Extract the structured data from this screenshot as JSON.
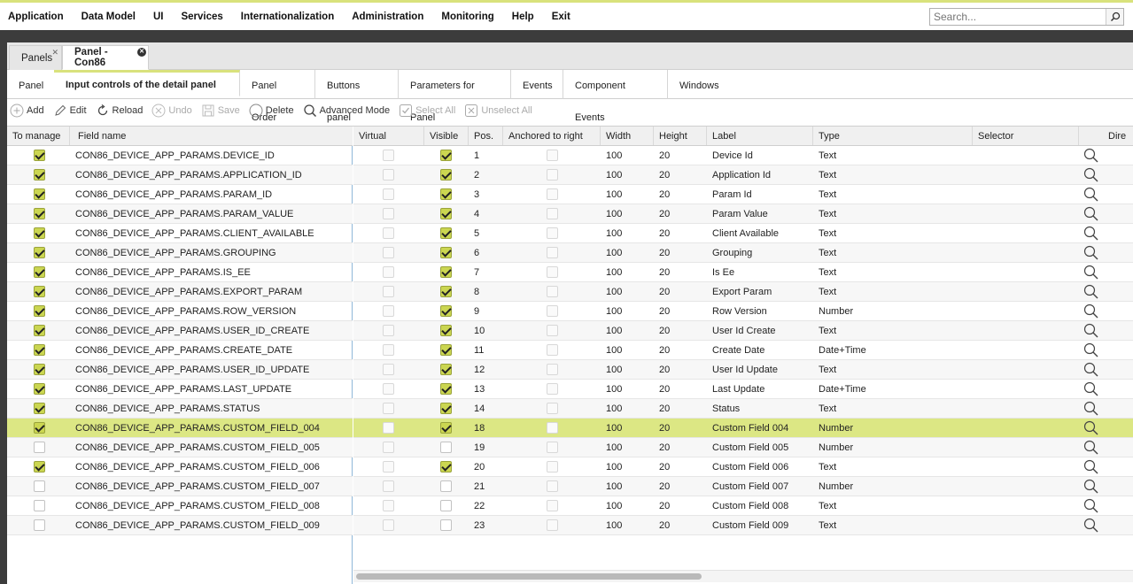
{
  "menu": [
    "Application",
    "Data Model",
    "UI",
    "Services",
    "Internationalization",
    "Administration",
    "Monitoring",
    "Help",
    "Exit"
  ],
  "search": {
    "placeholder": "Search..."
  },
  "doc_tabs": [
    {
      "label": "Panels",
      "active": false
    },
    {
      "label": "Panel - Con86",
      "active": true
    }
  ],
  "sub_tabs": [
    "Panel",
    "Input controls of the detail panel",
    "Panel Order",
    "Buttons panel",
    "Parameters for Panel",
    "Events",
    "Component Events",
    "Windows"
  ],
  "sub_tab_active": 1,
  "toolbar": {
    "add": "Add",
    "edit": "Edit",
    "reload": "Reload",
    "undo": "Undo",
    "save": "Save",
    "delete": "Delete",
    "advanced": "Advanced Mode",
    "select_all": "Select All",
    "unselect_all": "Unselect All"
  },
  "columns": {
    "to_manage": "To manage",
    "field_name": "Field name",
    "virtual": "Virtual",
    "visible": "Visible",
    "pos": "Pos.",
    "anchored": "Anchored to right",
    "width": "Width",
    "height": "Height",
    "label": "Label",
    "type": "Type",
    "selector": "Selector",
    "dir": "Dire"
  },
  "rows": [
    {
      "manage": true,
      "field": "CON86_DEVICE_APP_PARAMS.DEVICE_ID",
      "virtual": false,
      "visible": true,
      "pos": "1",
      "width": "100",
      "height": "20",
      "label": "Device Id",
      "type": "Text"
    },
    {
      "manage": true,
      "field": "CON86_DEVICE_APP_PARAMS.APPLICATION_ID",
      "virtual": false,
      "visible": true,
      "pos": "2",
      "width": "100",
      "height": "20",
      "label": "Application Id",
      "type": "Text"
    },
    {
      "manage": true,
      "field": "CON86_DEVICE_APP_PARAMS.PARAM_ID",
      "virtual": false,
      "visible": true,
      "pos": "3",
      "width": "100",
      "height": "20",
      "label": "Param Id",
      "type": "Text"
    },
    {
      "manage": true,
      "field": "CON86_DEVICE_APP_PARAMS.PARAM_VALUE",
      "virtual": false,
      "visible": true,
      "pos": "4",
      "width": "100",
      "height": "20",
      "label": "Param Value",
      "type": "Text"
    },
    {
      "manage": true,
      "field": "CON86_DEVICE_APP_PARAMS.CLIENT_AVAILABLE",
      "virtual": false,
      "visible": true,
      "pos": "5",
      "width": "100",
      "height": "20",
      "label": "Client Available",
      "type": "Text"
    },
    {
      "manage": true,
      "field": "CON86_DEVICE_APP_PARAMS.GROUPING",
      "virtual": false,
      "visible": true,
      "pos": "6",
      "width": "100",
      "height": "20",
      "label": "Grouping",
      "type": "Text"
    },
    {
      "manage": true,
      "field": "CON86_DEVICE_APP_PARAMS.IS_EE",
      "virtual": false,
      "visible": true,
      "pos": "7",
      "width": "100",
      "height": "20",
      "label": "Is Ee",
      "type": "Text"
    },
    {
      "manage": true,
      "field": "CON86_DEVICE_APP_PARAMS.EXPORT_PARAM",
      "virtual": false,
      "visible": true,
      "pos": "8",
      "width": "100",
      "height": "20",
      "label": "Export Param",
      "type": "Text"
    },
    {
      "manage": true,
      "field": "CON86_DEVICE_APP_PARAMS.ROW_VERSION",
      "virtual": false,
      "visible": true,
      "pos": "9",
      "width": "100",
      "height": "20",
      "label": "Row Version",
      "type": "Number"
    },
    {
      "manage": true,
      "field": "CON86_DEVICE_APP_PARAMS.USER_ID_CREATE",
      "virtual": false,
      "visible": true,
      "pos": "10",
      "width": "100",
      "height": "20",
      "label": "User Id Create",
      "type": "Text"
    },
    {
      "manage": true,
      "field": "CON86_DEVICE_APP_PARAMS.CREATE_DATE",
      "virtual": false,
      "visible": true,
      "pos": "11",
      "width": "100",
      "height": "20",
      "label": "Create Date",
      "type": "Date+Time"
    },
    {
      "manage": true,
      "field": "CON86_DEVICE_APP_PARAMS.USER_ID_UPDATE",
      "virtual": false,
      "visible": true,
      "pos": "12",
      "width": "100",
      "height": "20",
      "label": "User Id Update",
      "type": "Text"
    },
    {
      "manage": true,
      "field": "CON86_DEVICE_APP_PARAMS.LAST_UPDATE",
      "virtual": false,
      "visible": true,
      "pos": "13",
      "width": "100",
      "height": "20",
      "label": "Last Update",
      "type": "Date+Time"
    },
    {
      "manage": true,
      "field": "CON86_DEVICE_APP_PARAMS.STATUS",
      "virtual": false,
      "visible": true,
      "pos": "14",
      "width": "100",
      "height": "20",
      "label": "Status",
      "type": "Text"
    },
    {
      "manage": true,
      "field": "CON86_DEVICE_APP_PARAMS.CUSTOM_FIELD_004",
      "virtual": false,
      "visible": true,
      "pos": "18",
      "width": "100",
      "height": "20",
      "label": "Custom Field 004",
      "type": "Number",
      "selected": true
    },
    {
      "manage": false,
      "field": "CON86_DEVICE_APP_PARAMS.CUSTOM_FIELD_005",
      "virtual": false,
      "visible": false,
      "pos": "19",
      "width": "100",
      "height": "20",
      "label": "Custom Field 005",
      "type": "Number"
    },
    {
      "manage": true,
      "field": "CON86_DEVICE_APP_PARAMS.CUSTOM_FIELD_006",
      "virtual": false,
      "visible": true,
      "pos": "20",
      "width": "100",
      "height": "20",
      "label": "Custom Field 006",
      "type": "Text"
    },
    {
      "manage": false,
      "field": "CON86_DEVICE_APP_PARAMS.CUSTOM_FIELD_007",
      "virtual": false,
      "visible": false,
      "pos": "21",
      "width": "100",
      "height": "20",
      "label": "Custom Field 007",
      "type": "Number"
    },
    {
      "manage": false,
      "field": "CON86_DEVICE_APP_PARAMS.CUSTOM_FIELD_008",
      "virtual": false,
      "visible": false,
      "pos": "22",
      "width": "100",
      "height": "20",
      "label": "Custom Field 008",
      "type": "Text"
    },
    {
      "manage": false,
      "field": "CON86_DEVICE_APP_PARAMS.CUSTOM_FIELD_009",
      "virtual": false,
      "visible": false,
      "pos": "23",
      "width": "100",
      "height": "20",
      "label": "Custom Field 009",
      "type": "Text"
    }
  ],
  "colors": {
    "accent": "#d9e27c",
    "selected_row": "#dce784",
    "checkbox_on": "#cbd651"
  }
}
